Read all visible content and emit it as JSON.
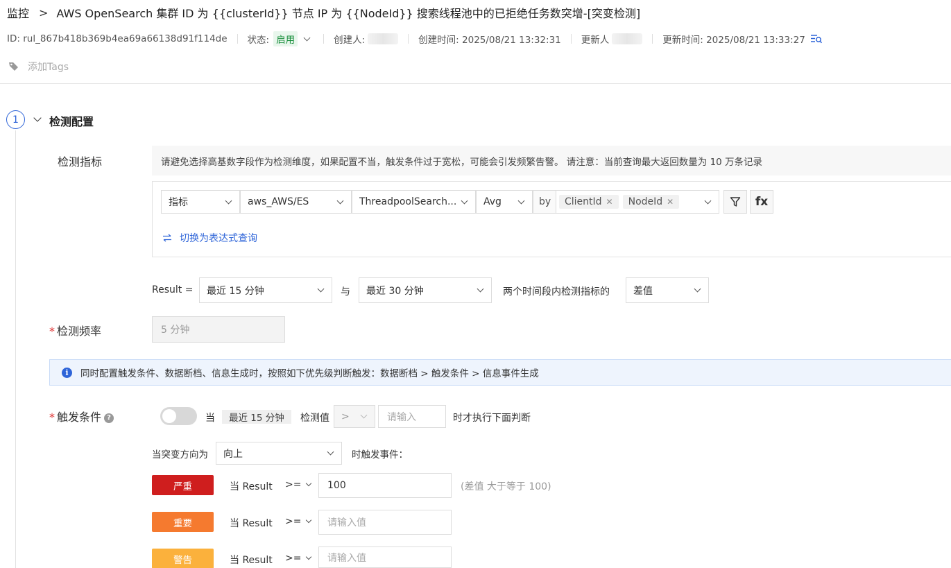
{
  "header": {
    "breadcrumb_root": "监控",
    "breadcrumb_sep": ">",
    "title": "AWS OpenSearch 集群 ID 为 {{clusterId}} 节点 IP 为 {{NodeId}} 搜索线程池中的已拒绝任务数突增-[突变检测]"
  },
  "meta": {
    "id": "ID: rul_867b418b369b4ea69a66138d91f114de",
    "status_label": "状态:",
    "status_value": "启用",
    "creator_label": "创建人:",
    "created_time": "创建时间: 2025/08/21 13:32:31",
    "updater_label": "更新人",
    "updated_time": "更新时间: 2025/08/21 13:33:27"
  },
  "tags": {
    "add_label": "添加Tags"
  },
  "section": {
    "step": "1",
    "title": "检测配置"
  },
  "metric": {
    "label": "检测指标",
    "hint": "请避免选择高基数字段作为检测维度，如果配置不当，触发条件过于宽松，可能会引发频繁告警。 请注意：当前查询最大返回数量为 10 万条记录",
    "type": "指标",
    "namespace": "aws_AWS/ES",
    "metric_name": "ThreadpoolSearch...",
    "agg": "Avg",
    "by": "by",
    "dimensions": [
      "ClientId",
      "NodeId"
    ],
    "filter_icon": "filter-icon",
    "fx_label": "fx",
    "switch_label": "切换为表达式查询"
  },
  "result": {
    "prefix": "Result =",
    "period_a": "最近 15 分钟",
    "with": "与",
    "period_b": "最近 30 分钟",
    "between": "两个时间段内检测指标的",
    "mode": "差值"
  },
  "frequency": {
    "label": "检测频率",
    "value": "5 分钟"
  },
  "info": {
    "icon": "info-icon",
    "text": "同时配置触发条件、数据断档、信息生成时，按照如下优先级判断触发：数据断档 > 触发条件 > 信息事件生成"
  },
  "trigger": {
    "label": "触发条件",
    "when": "当",
    "period": "最近 15 分钟",
    "check_value": "检测值",
    "operator": ">",
    "input_placeholder": "请输入",
    "then": "时才执行下面判断",
    "direction_label": "当突变方向为",
    "direction_value": "向上",
    "event_label": "时触发事件：",
    "rules": [
      {
        "level": "严重",
        "color": "#cf1e1e",
        "when": "当 Result",
        "op": ">=",
        "value": "100",
        "placeholder": "",
        "desc": "(差值 大于等于 100)"
      },
      {
        "level": "重要",
        "color": "#f57a2f",
        "when": "当 Result",
        "op": ">=",
        "value": "",
        "placeholder": "请输入值",
        "desc": ""
      },
      {
        "level": "警告",
        "color": "#fbb13c",
        "when": "当 Result",
        "op": ">=",
        "value": "",
        "placeholder": "请输入值",
        "desc": ""
      }
    ]
  }
}
